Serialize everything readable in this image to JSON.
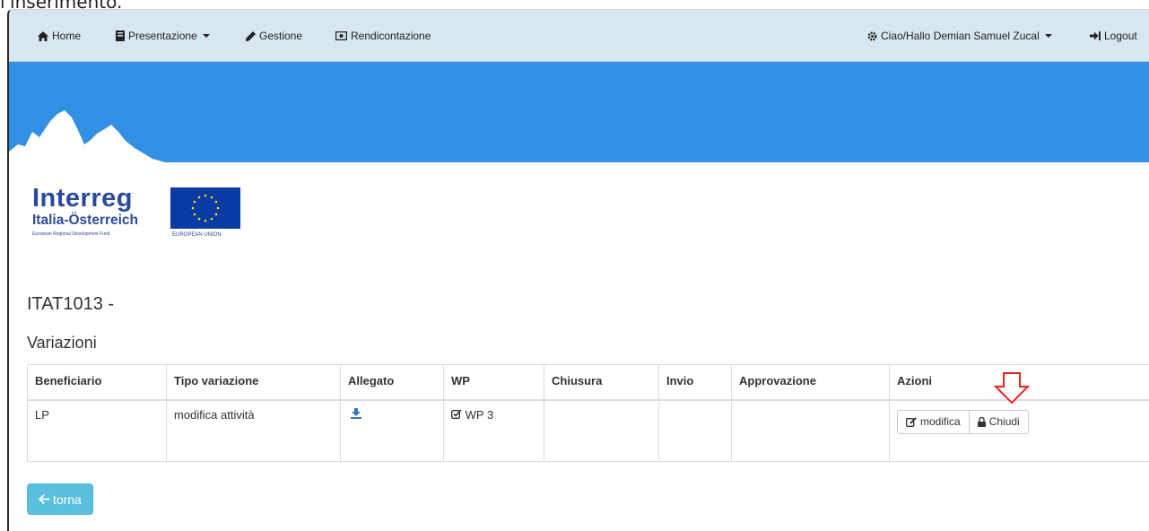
{
  "doc_caption": "l'inserimento.",
  "nav": {
    "home": "Home",
    "presentazione": "Presentazione",
    "gestione": "Gestione",
    "rendicontazione": "Rendicontazione",
    "user": "Ciao/Hallo Demian Samuel Zucal",
    "logout": "Logout"
  },
  "logo": {
    "word": "Interreg",
    "sub": "Italia-Österreich",
    "fund": "European Regional Development Fund",
    "eu": "EUROPEAN UNION"
  },
  "page": {
    "project_code": "ITAT1013 -",
    "section_title": "Variazioni"
  },
  "table": {
    "headers": [
      "Beneficiario",
      "Tipo variazione",
      "Allegato",
      "WP",
      "Chiusura",
      "Invio",
      "Approvazione",
      "Azioni"
    ],
    "rows": [
      {
        "beneficiario": "LP",
        "tipo": "modifica attività",
        "wp": "WP 3",
        "chiusura": "",
        "invio": "",
        "approvazione": "",
        "action_edit": "modifica",
        "action_close": "Chiudi"
      }
    ]
  },
  "back_button": "torna",
  "colors": {
    "navbar": "#d8e6f0",
    "banner": "#318fe4",
    "back_button": "#5bc0de",
    "annotation_arrow": "#e8231c",
    "link_icon": "#337ab7"
  },
  "icons": [
    "home-icon",
    "book-icon",
    "pencil-icon",
    "money-icon",
    "gear-icon",
    "logout-icon",
    "download-icon",
    "check-square-icon",
    "edit-icon",
    "lock-icon",
    "arrow-left-icon",
    "red-down-arrow-annotation"
  ]
}
